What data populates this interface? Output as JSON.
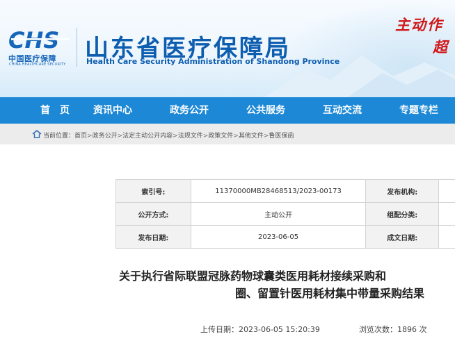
{
  "header": {
    "logo_mark": "CHS",
    "logo_cn": "中国医疗保障",
    "logo_en": "CHINA HEALTHCARE SECURITY",
    "title": "山东省医疗保障局",
    "subtitle": "Health Care Security Administration of Shandong Province",
    "slogan_line1": "主动作",
    "slogan_line2": "超",
    "brand_color": "#0d5db0",
    "slogan_color": "#d0181a"
  },
  "nav": {
    "bg_color": "#1d88d6",
    "items": [
      {
        "label": "首　页"
      },
      {
        "label": "资讯中心"
      },
      {
        "label": "政务公开"
      },
      {
        "label": "公共服务"
      },
      {
        "label": "互动交流"
      },
      {
        "label": "专题专栏"
      }
    ]
  },
  "breadcrumb": {
    "icon": "home-icon",
    "prefix": "当前位置：",
    "separator": ">",
    "items": [
      "首页",
      "政务公开",
      "法定主动公开内容",
      "法规文件",
      "政策文件",
      "其他文件",
      "鲁医保函"
    ]
  },
  "info": {
    "row1": {
      "label": "索引号:",
      "value": "11370000MB28468513/2023-00173",
      "label2": "发布机构:",
      "value2": ""
    },
    "row2": {
      "label": "公开方式:",
      "value": "主动公开",
      "label2": "组配分类:",
      "value2": ""
    },
    "row3": {
      "label": "发布日期:",
      "value": "2023-06-05",
      "label2": "成文日期:",
      "value2": ""
    }
  },
  "article": {
    "title_line1": "关于执行省际联盟冠脉药物球囊类医用耗材接续采购和",
    "title_line2": "圈、留置针医用耗材集中带量采购结果",
    "upload_label": "上传日期：",
    "upload_value": "2023-06-05 15:20:39",
    "views_label": "浏览次数：",
    "views_value": "1896",
    "views_unit": "次"
  }
}
